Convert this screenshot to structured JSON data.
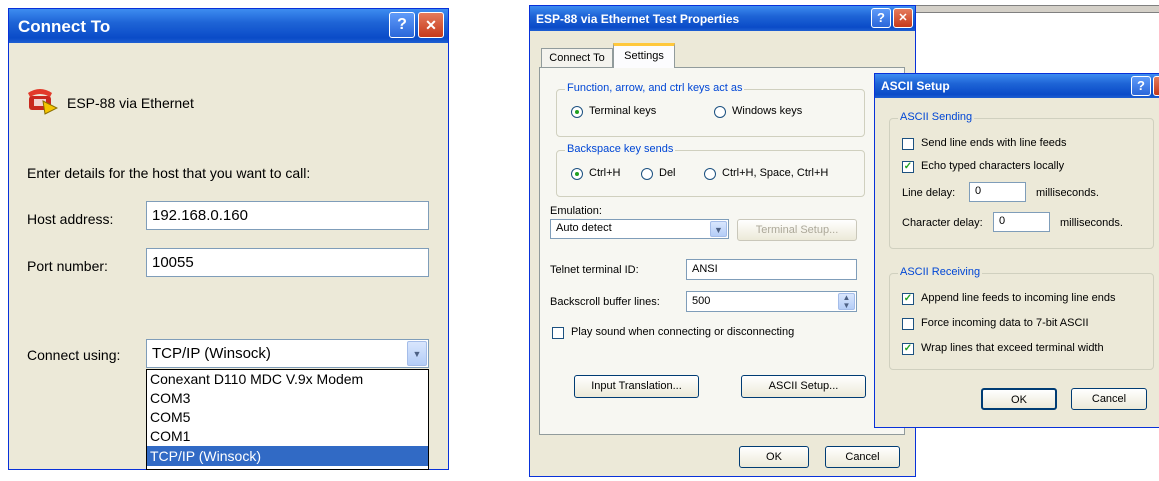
{
  "connect_to": {
    "title": "Connect To",
    "help_glyph": "?",
    "close_glyph": "✕",
    "connection_name": "ESP-88 via Ethernet",
    "instructions": "Enter details for the host that you want to call:",
    "host_label": "Host address:",
    "host_value": "192.168.0.160",
    "port_label": "Port number:",
    "port_value": "10055",
    "connect_using_label": "Connect using:",
    "connect_using_value": "TCP/IP (Winsock)",
    "options": [
      "Conexant D110 MDC V.9x Modem",
      "COM3",
      "COM5",
      "COM1",
      "TCP/IP (Winsock)"
    ],
    "selected_option": "TCP/IP (Winsock)"
  },
  "properties": {
    "title": "ESP-88 via Ethernet Test Properties",
    "tabs": [
      "Connect To",
      "Settings"
    ],
    "active_tab": "Settings",
    "function_keys": {
      "legend": "Function, arrow, and ctrl keys act as",
      "option_terminal": "Terminal keys",
      "option_windows": "Windows keys",
      "selected": "Terminal keys"
    },
    "backspace": {
      "legend": "Backspace key sends",
      "option_ctrlh": "Ctrl+H",
      "option_del": "Del",
      "option_combo": "Ctrl+H, Space, Ctrl+H",
      "selected": "Ctrl+H"
    },
    "emulation_label": "Emulation:",
    "emulation_value": "Auto detect",
    "terminal_setup_label": "Terminal Setup...",
    "telnet_id_label": "Telnet terminal ID:",
    "telnet_id_value": "ANSI",
    "backscroll_label": "Backscroll buffer lines:",
    "backscroll_value": "500",
    "play_sound_label": "Play sound when connecting or disconnecting",
    "play_sound_checked": false,
    "input_translation_label": "Input Translation...",
    "ascii_setup_label": "ASCII Setup...",
    "ok_label": "OK",
    "cancel_label": "Cancel"
  },
  "ascii_setup": {
    "title": "ASCII Setup",
    "sending_legend": "ASCII Sending",
    "send_line_ends_label": "Send line ends with line feeds",
    "send_line_ends_checked": false,
    "echo_label": "Echo typed characters locally",
    "echo_checked": true,
    "line_delay_label": "Line delay:",
    "line_delay_value": "0",
    "line_delay_unit": "milliseconds.",
    "char_delay_label": "Character delay:",
    "char_delay_value": "0",
    "char_delay_unit": "milliseconds.",
    "receiving_legend": "ASCII Receiving",
    "append_label": "Append line feeds to incoming line ends",
    "append_checked": true,
    "force_label": "Force incoming data to 7-bit ASCII",
    "force_checked": false,
    "wrap_label": "Wrap lines that exceed terminal width",
    "wrap_checked": true,
    "ok_label": "OK",
    "cancel_label": "Cancel"
  },
  "colors": {
    "titlebar": "#0a4bc8",
    "window_bg": "#ece9d8",
    "selection": "#316ac5",
    "groupbox_title": "#0046d5"
  }
}
